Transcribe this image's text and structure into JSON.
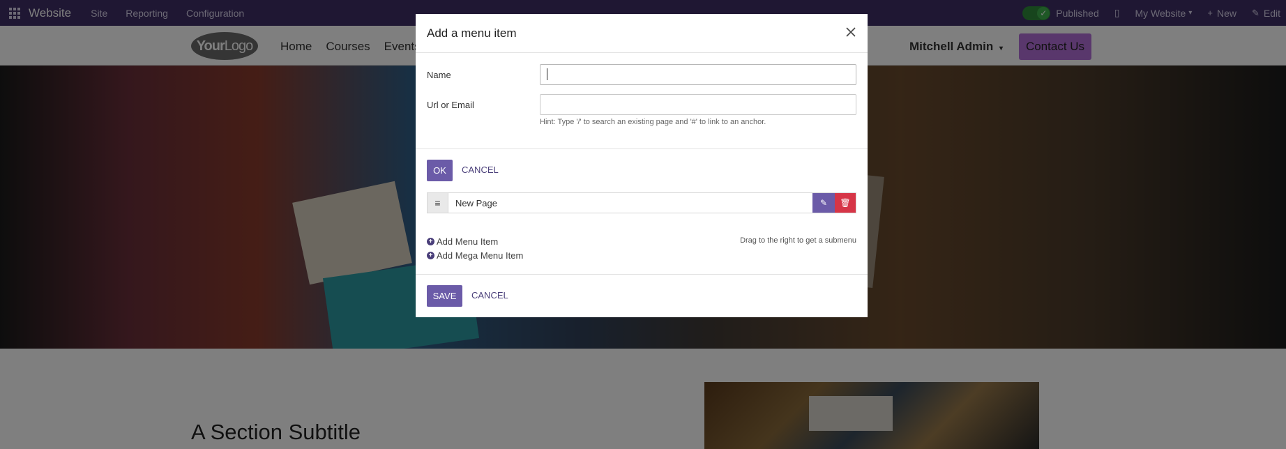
{
  "topbar": {
    "brand": "Website",
    "nav": [
      "Site",
      "Reporting",
      "Configuration"
    ],
    "published_label": "Published",
    "my_website_label": "My Website",
    "new_label": "New",
    "edit_label": "Edit"
  },
  "site_header": {
    "logo_bold": "Your",
    "logo_thin": "Logo",
    "nav": [
      "Home",
      "Courses",
      "Events"
    ],
    "user": "Mitchell Admin",
    "contact_button": "Contact Us"
  },
  "content": {
    "section_subtitle": "A Section Subtitle"
  },
  "menu_editor": {
    "row_label": "New Page",
    "add_menu_item": "Add Menu Item",
    "add_mega_menu_item": "Add Mega Menu Item",
    "drag_hint": "Drag to the right to get a submenu",
    "save_label": "SAVE",
    "cancel_label": "CANCEL"
  },
  "modal": {
    "title": "Add a menu item",
    "name_label": "Name",
    "name_value": "",
    "url_label": "Url or Email",
    "url_value": "",
    "hint": "Hint: Type '/' to search an existing page and '#' to link to an anchor.",
    "ok_label": "OK",
    "cancel_label": "CANCEL"
  },
  "colors": {
    "topbar": "#3e2f66",
    "primary": "#6b5ba8",
    "danger": "#d63547",
    "contact_button": "#b36fd9",
    "published_toggle": "#2f8a3a"
  }
}
